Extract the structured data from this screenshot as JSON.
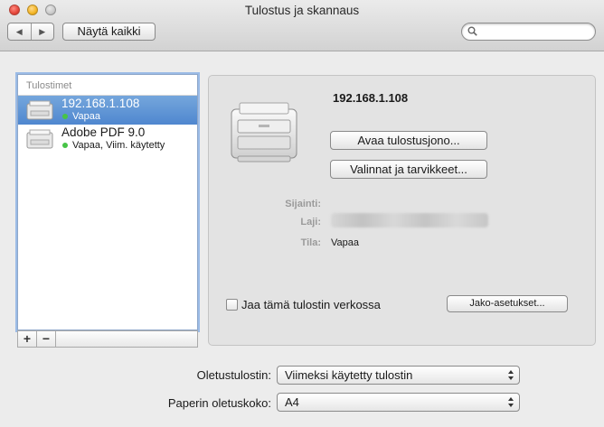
{
  "window": {
    "title": "Tulostus ja skannaus"
  },
  "toolbar": {
    "back_icon": "back-arrow-icon",
    "forward_icon": "forward-arrow-icon",
    "show_all_label": "Näytä kaikki",
    "search_placeholder": ""
  },
  "printers_list": {
    "header": "Tulostimet",
    "items": [
      {
        "name": "192.168.1.108",
        "status": "Vapaa",
        "selected": true
      },
      {
        "name": "Adobe PDF 9.0",
        "status": "Vapaa, Viim. käytetty",
        "selected": false
      }
    ],
    "add_label": "+",
    "remove_label": "−"
  },
  "details": {
    "printer_name": "192.168.1.108",
    "open_queue_label": "Avaa tulostusjono...",
    "options_label": "Valinnat ja tarvikkeet...",
    "location_label": "Sijainti:",
    "location_value": "",
    "kind_label": "Laji:",
    "status_label": "Tila:",
    "status_value": "Vapaa",
    "share_label": "Jaa tämä tulostin verkossa",
    "share_checked": false,
    "sharing_settings_label": "Jako-asetukset..."
  },
  "defaults": {
    "default_printer_label": "Oletustulostin:",
    "default_printer_value": "Viimeksi käytetty tulostin",
    "paper_size_label": "Paperin oletuskoko:",
    "paper_size_value": "A4"
  },
  "colors": {
    "selection": "#4f87cf",
    "status_dot": "#47c447",
    "focus_ring": "#9bbbe6"
  }
}
